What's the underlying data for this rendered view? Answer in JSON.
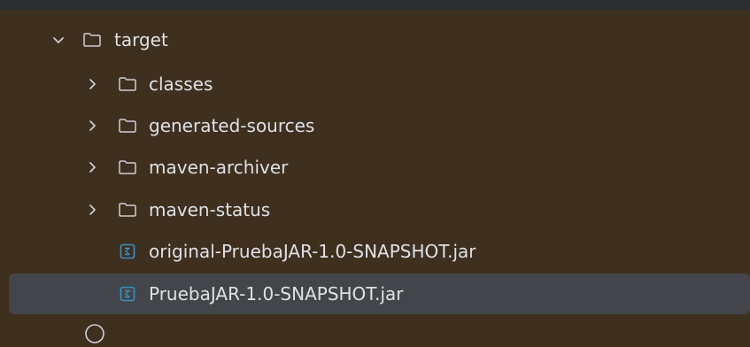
{
  "project_tree": {
    "target": {
      "label": "target",
      "chevron": "chevron-down-icon",
      "icon": "folder-icon",
      "children": [
        {
          "label": "classes",
          "chevron": "chevron-right-icon",
          "icon": "folder-icon"
        },
        {
          "label": "generated-sources",
          "chevron": "chevron-right-icon",
          "icon": "folder-icon"
        },
        {
          "label": "maven-archiver",
          "chevron": "chevron-right-icon",
          "icon": "folder-icon"
        },
        {
          "label": "maven-status",
          "chevron": "chevron-right-icon",
          "icon": "folder-icon"
        },
        {
          "label": "original-PruebaJAR-1.0-SNAPSHOT.jar",
          "icon": "jar-file-icon"
        },
        {
          "label": "PruebaJAR-1.0-SNAPSHOT.jar",
          "icon": "jar-file-icon",
          "selected": true
        }
      ]
    }
  },
  "colors": {
    "background": "#3f2f1f",
    "selection": "#43454a",
    "text": "#dfe1e5",
    "icon_stroke": "#ced0d6",
    "jar_icon": "#3592c4"
  }
}
